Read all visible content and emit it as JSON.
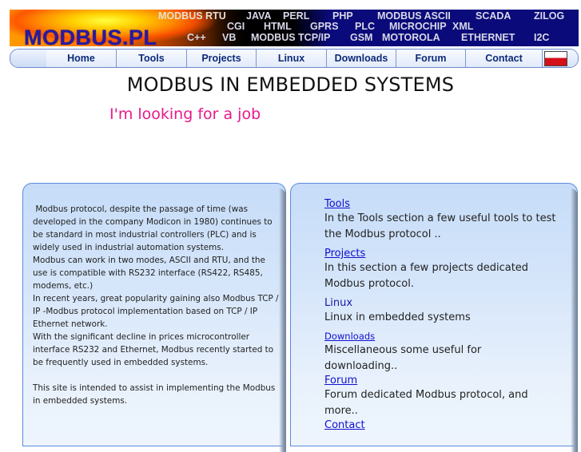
{
  "banner": {
    "logo": "MODBUS.PL",
    "keywords": [
      "MODBUS RTU",
      "JAVA",
      "PERL",
      "PHP",
      "MODBUS ASCII",
      "SCADA",
      "ZILOG",
      "CGI",
      "HTML",
      "GPRS",
      "PLC",
      "MICROCHIP",
      "XML",
      "C++",
      "VB",
      "MODBUS TCP/IP",
      "GSM",
      "MOTOROLA",
      "ETHERNET",
      "I2C"
    ]
  },
  "nav": {
    "items": [
      {
        "label": "Home"
      },
      {
        "label": "Tools"
      },
      {
        "label": "Projects"
      },
      {
        "label": "Linux"
      },
      {
        "label": "Downloads"
      },
      {
        "label": "Forum"
      },
      {
        "label": "Contact"
      }
    ],
    "flag": "polish-flag-icon"
  },
  "page": {
    "title": "MODBUS IN EMBEDDED SYSTEMS",
    "job_notice": "I'm looking for a job"
  },
  "intro": {
    "paragraphs": [
      " Modbus protocol, despite the passage of time (was developed in the company Modicon in 1980) continues to be standard in most industrial controllers (PLC) and is widely used in industrial automation systems.",
      "Modbus can work in two modes, ASCII and RTU, and the use is compatible with RS232 interface (RS422, RS485, modems, etc.)",
      "In recent years, great popularity gaining also Modbus TCP / IP -Modbus protocol implementation based on TCP / IP Ethernet network.",
      "With the significant decline in prices microcontroller interface RS232 and Ethernet, Modbus recently started to be frequently used in embedded systems.",
      "This site is intended to assist in implementing the Modbus in embedded systems."
    ]
  },
  "sections": [
    {
      "link": "Tools",
      "desc": "In the Tools section a few useful tools to test the Modbus protocol .."
    },
    {
      "link": "Projects",
      "desc": "In this section a few  projects dedicated Modbus protocol."
    },
    {
      "link": "Linux",
      "desc": "Linux in embedded systems"
    },
    {
      "link": "Downloads",
      "desc": "Miscellaneous some useful for downloading.."
    },
    {
      "link": "Forum",
      "desc": "Forum dedicated Modbus protocol, and more.."
    },
    {
      "link": "Contact",
      "desc": ""
    }
  ],
  "colors": {
    "banner_navy": "#0a0a7a",
    "logo": "#2a1aa0",
    "nav_text": "#0c2a78",
    "job_notice": "#e8198b",
    "link": "#1010d0",
    "panel_border": "#5a8ae0"
  }
}
